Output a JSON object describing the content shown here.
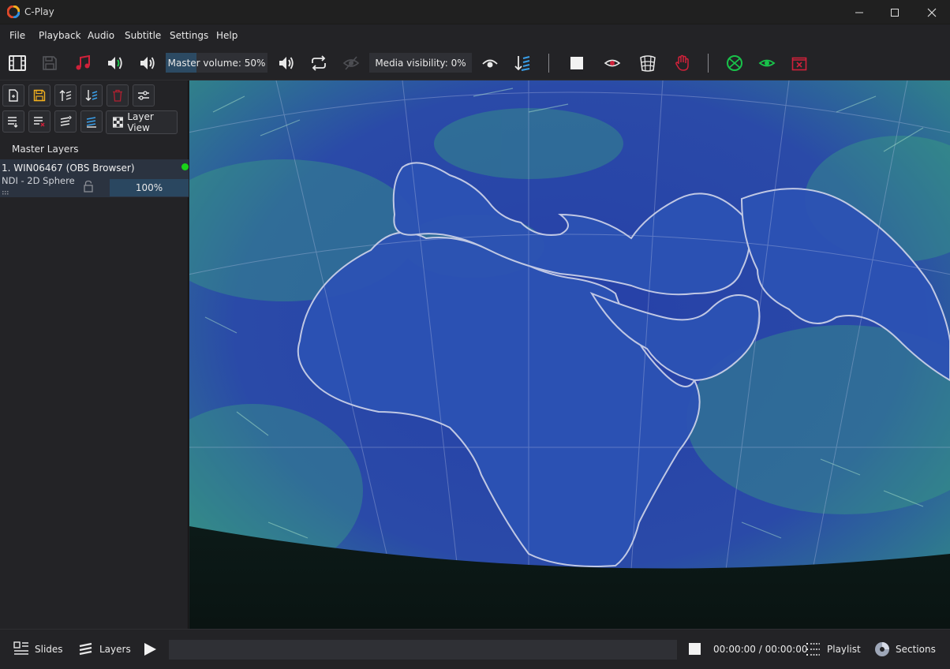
{
  "window": {
    "title": "C-Play"
  },
  "menu": {
    "items": [
      "File",
      "Playback",
      "Audio",
      "Subtitle",
      "Settings",
      "Help"
    ]
  },
  "toolbar": {
    "icons": [
      "film-icon",
      "save-disabled-icon",
      "music-note-icon",
      "audio-left-icon",
      "audio-right-icon",
      "speaker-icon",
      "repeat-icon",
      "visibility-off-icon",
      "eye-icon",
      "sort-icon",
      "stop-icon",
      "eye-outline-icon",
      "grid-dome-icon",
      "hand-icon",
      "globe-icon",
      "eye-green-icon",
      "close-box-icon"
    ],
    "master_volume_label": "Master volume: 50%",
    "master_volume_level": 0.3,
    "media_visibility_label": "Media visibility: 0%",
    "media_visibility_level": 0
  },
  "sidebar": {
    "buttons_row1": [
      "new-file-icon",
      "save-icon",
      "move-up-icon",
      "move-down-icon",
      "delete-icon",
      "settings-sliders-icon"
    ],
    "buttons_row2": [
      "layer-add-icon",
      "layer-remove-icon",
      "layer-up-icon",
      "layer-down-icon"
    ],
    "layer_view_label": "Layer View",
    "section_title": "Master Layers",
    "layers": [
      {
        "name": "1. WIN06467 (OBS Browser)",
        "type": "NDI - 2D Sphere",
        "opacity": "100%",
        "status_color": "#19d219"
      }
    ]
  },
  "bottombar": {
    "slides_label": "Slides",
    "layers_label": "Layers",
    "time": "00:00:00 / 00:00:00",
    "playlist_label": "Playlist",
    "sections_label": "Sections"
  },
  "colors": {
    "accent": "#2c4a63",
    "red_icon": "#d0213a",
    "green_icon": "#19c24a",
    "ocean": "#2a3fa0",
    "land": "#2b56b4",
    "wind_green": "#3fb873"
  }
}
